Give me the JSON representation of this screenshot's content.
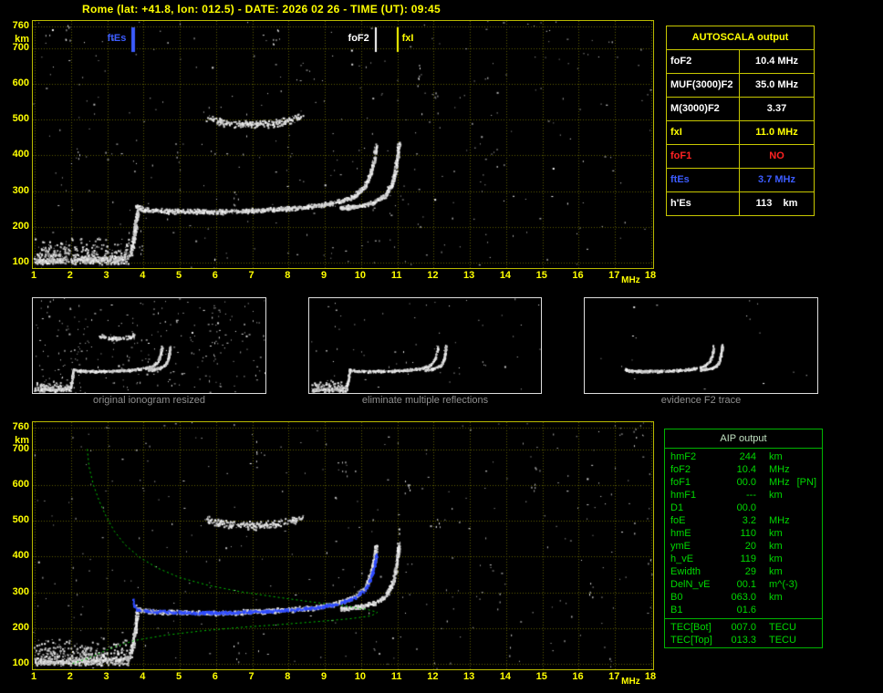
{
  "header": {
    "title": "Rome (lat: +41.8, lon: 012.5) - DATE: 2026 02 26 - TIME (UT): 09:45"
  },
  "colors": {
    "axis_yellow": "#ffff00",
    "grid_olive": "#5f5f00",
    "trace_white": "#ffffff",
    "ftes_blue": "#3c5cff",
    "fxi_yellow": "#ffff00",
    "fof1_red": "#ff2222",
    "profile_green": "#00c800",
    "caption_gray": "#8f8f8f"
  },
  "autoscala_table": {
    "title": "AUTOSCALA output",
    "rows": [
      {
        "label": "foF2",
        "value": "10.4 MHz",
        "color": "#ffffff"
      },
      {
        "label": "MUF(3000)F2",
        "value": "35.0 MHz",
        "color": "#ffffff"
      },
      {
        "label": "M(3000)F2",
        "value": "3.37",
        "color": "#ffffff"
      },
      {
        "label": "fxI",
        "value": "11.0 MHz",
        "color": "#ffff00"
      },
      {
        "label": "foF1",
        "value": "NO",
        "color": "#ff2222"
      },
      {
        "label": "ftEs",
        "value": "3.7 MHz",
        "color": "#3c5cff"
      },
      {
        "label": "h'Es",
        "value": "113    km",
        "color": "#ffffff"
      }
    ]
  },
  "aip_table": {
    "title": "AIP output",
    "rows": [
      {
        "name": "hmF2",
        "value": "244",
        "unit": "km",
        "extra": ""
      },
      {
        "name": "foF2",
        "value": "10.4",
        "unit": "MHz",
        "extra": ""
      },
      {
        "name": "foF1",
        "value": "00.0",
        "unit": "MHz",
        "extra": "[PN]"
      },
      {
        "name": "hmF1",
        "value": "---",
        "unit": "km",
        "extra": ""
      },
      {
        "name": "D1",
        "value": "00.0",
        "unit": "",
        "extra": ""
      },
      {
        "name": "foE",
        "value": "3.2",
        "unit": "MHz",
        "extra": ""
      },
      {
        "name": "hmE",
        "value": "110",
        "unit": "km",
        "extra": ""
      },
      {
        "name": "ymE",
        "value": "20",
        "unit": "km",
        "extra": ""
      },
      {
        "name": "h_vE",
        "value": "119",
        "unit": "km",
        "extra": ""
      },
      {
        "name": "Ewidth",
        "value": "29",
        "unit": "km",
        "extra": ""
      },
      {
        "name": "DelN_vE",
        "value": "00.1",
        "unit": "m^(-3)",
        "extra": ""
      },
      {
        "name": "B0",
        "value": "063.0",
        "unit": "km",
        "extra": ""
      },
      {
        "name": "B1",
        "value": "01.6",
        "unit": "",
        "extra": ""
      }
    ],
    "tec_rows": [
      {
        "name": "TEC[Bot]",
        "value": "007.0",
        "unit": "TECU",
        "extra": ""
      },
      {
        "name": "TEC[Top]",
        "value": "013.3",
        "unit": "TECU",
        "extra": ""
      }
    ]
  },
  "thumbnails": [
    {
      "caption": "original ionogram resized",
      "mode": "original"
    },
    {
      "caption": "eliminate multiple reflections",
      "mode": "filtered"
    },
    {
      "caption": "evidence F2 trace",
      "mode": "trace"
    }
  ],
  "chart_data": [
    {
      "id": "main-ionogram",
      "type": "scatter",
      "title": "recorded ionogram with autoscaled characteristics",
      "xlabel": "MHz",
      "ylabel": "km",
      "xlim": [
        1,
        18
      ],
      "ylim": [
        100,
        760
      ],
      "x_ticks": [
        1,
        2,
        3,
        4,
        5,
        6,
        7,
        8,
        9,
        10,
        11,
        12,
        13,
        14,
        15,
        16,
        17,
        18
      ],
      "y_ticks": [
        100,
        200,
        300,
        400,
        500,
        600,
        700,
        760
      ],
      "grid": true,
      "markers": [
        {
          "label": "ftEs",
          "x": 3.7,
          "color": "#3c5cff",
          "align": "left"
        },
        {
          "label": "foF2",
          "x": 10.4,
          "color": "#ffffff",
          "align": "left"
        },
        {
          "label": "fxI",
          "x": 11.0,
          "color": "#ffff00",
          "align": "right"
        }
      ],
      "noise": {
        "uniform": 330
      },
      "series": [
        {
          "name": "F2-ordinary-trace",
          "color": "#ffffff",
          "style": "scatter",
          "density": 950,
          "jitter": [
            2,
            3
          ],
          "points": [
            [
              3.78,
              260
            ],
            [
              3.95,
              251
            ],
            [
              4.4,
              246
            ],
            [
              5.2,
              244
            ],
            [
              6.2,
              244
            ],
            [
              7.2,
              248
            ],
            [
              8.1,
              253
            ],
            [
              8.8,
              260
            ],
            [
              9.35,
              271
            ],
            [
              9.8,
              288
            ],
            [
              10.08,
              312
            ],
            [
              10.25,
              348
            ],
            [
              10.35,
              390
            ],
            [
              10.41,
              433
            ]
          ]
        },
        {
          "name": "F2-extraordinary-trace",
          "color": "#ffffff",
          "style": "scatter",
          "density": 420,
          "jitter": [
            2,
            3
          ],
          "points": [
            [
              9.4,
              254
            ],
            [
              9.95,
              260
            ],
            [
              10.35,
              270
            ],
            [
              10.65,
              290
            ],
            [
              10.83,
              320
            ],
            [
              10.93,
              358
            ],
            [
              10.99,
              400
            ],
            [
              11.03,
              437
            ]
          ]
        },
        {
          "name": "Es-trace",
          "color": "#ffffff",
          "style": "scatter",
          "density": 170,
          "jitter": [
            2,
            3
          ],
          "points": [
            [
              1.05,
              104
            ],
            [
              1.8,
              108
            ],
            [
              2.6,
              111
            ],
            [
              3.3,
              114
            ],
            [
              3.6,
              118
            ]
          ]
        },
        {
          "name": "Es-cusp",
          "color": "#ffffff",
          "style": "scatter",
          "density": 160,
          "jitter": [
            2,
            4
          ],
          "points": [
            [
              3.62,
              125
            ],
            [
              3.7,
              160
            ],
            [
              3.76,
              200
            ],
            [
              3.8,
              232
            ],
            [
              3.83,
              248
            ]
          ]
        },
        {
          "name": "second-hop-echo",
          "color": "#ffffff",
          "style": "scatter",
          "density": 240,
          "jitter": [
            3,
            5
          ],
          "points": [
            [
              5.75,
              506
            ],
            [
              6.15,
              494
            ],
            [
              6.6,
              488
            ],
            [
              7.15,
              488
            ],
            [
              7.65,
              493
            ],
            [
              8.05,
              500
            ],
            [
              8.35,
              510
            ]
          ]
        },
        {
          "name": "low-frequency-noise",
          "color": "#ffffff",
          "style": "blob",
          "density": 520,
          "region": [
            1.0,
            3.6,
            100,
            178
          ]
        }
      ]
    },
    {
      "id": "aip-ionogram",
      "type": "scatter",
      "title": "ionogram with fitted trace and electron density profile",
      "xlabel": "MHz",
      "ylabel": "km",
      "xlim": [
        1,
        18
      ],
      "ylim": [
        100,
        760
      ],
      "x_ticks": [
        1,
        2,
        3,
        4,
        5,
        6,
        7,
        8,
        9,
        10,
        11,
        12,
        13,
        14,
        15,
        16,
        17,
        18
      ],
      "y_ticks": [
        100,
        200,
        300,
        400,
        500,
        600,
        700,
        760
      ],
      "grid": true,
      "markers": [],
      "noise": {
        "uniform": 300
      },
      "series": [
        {
          "name": "F2-ordinary-trace",
          "color": "#ffffff",
          "style": "scatter",
          "density": 950,
          "jitter": [
            2,
            3
          ],
          "points": [
            [
              3.78,
              260
            ],
            [
              3.95,
              251
            ],
            [
              4.4,
              246
            ],
            [
              5.2,
              244
            ],
            [
              6.2,
              244
            ],
            [
              7.2,
              248
            ],
            [
              8.1,
              253
            ],
            [
              8.8,
              260
            ],
            [
              9.35,
              271
            ],
            [
              9.8,
              288
            ],
            [
              10.08,
              312
            ],
            [
              10.25,
              348
            ],
            [
              10.35,
              390
            ],
            [
              10.41,
              433
            ]
          ]
        },
        {
          "name": "F2-extraordinary-trace",
          "color": "#ffffff",
          "style": "scatter",
          "density": 420,
          "jitter": [
            2,
            3
          ],
          "points": [
            [
              9.4,
              254
            ],
            [
              9.95,
              260
            ],
            [
              10.35,
              270
            ],
            [
              10.65,
              290
            ],
            [
              10.83,
              320
            ],
            [
              10.93,
              358
            ],
            [
              10.99,
              400
            ],
            [
              11.03,
              437
            ]
          ]
        },
        {
          "name": "Es-trace",
          "color": "#ffffff",
          "style": "scatter",
          "density": 170,
          "jitter": [
            2,
            3
          ],
          "points": [
            [
              1.05,
              104
            ],
            [
              1.8,
              108
            ],
            [
              2.6,
              111
            ],
            [
              3.3,
              114
            ],
            [
              3.6,
              118
            ]
          ]
        },
        {
          "name": "Es-cusp",
          "color": "#ffffff",
          "style": "scatter",
          "density": 160,
          "jitter": [
            2,
            4
          ],
          "points": [
            [
              3.62,
              125
            ],
            [
              3.7,
              160
            ],
            [
              3.76,
              200
            ],
            [
              3.8,
              232
            ],
            [
              3.83,
              248
            ]
          ]
        },
        {
          "name": "second-hop-echo",
          "color": "#ffffff",
          "style": "scatter",
          "density": 240,
          "jitter": [
            3,
            5
          ],
          "points": [
            [
              5.75,
              506
            ],
            [
              6.15,
              494
            ],
            [
              6.6,
              488
            ],
            [
              7.15,
              488
            ],
            [
              7.65,
              493
            ],
            [
              8.05,
              500
            ],
            [
              8.35,
              510
            ]
          ]
        },
        {
          "name": "low-frequency-noise",
          "color": "#ffffff",
          "style": "blob",
          "density": 520,
          "region": [
            1.0,
            3.6,
            100,
            178
          ]
        },
        {
          "name": "electron-density-profile",
          "color": "#00c800",
          "style": "line",
          "dash": [
            2,
            3
          ],
          "points": [
            [
              2.45,
              700
            ],
            [
              2.5,
              650
            ],
            [
              2.62,
              600
            ],
            [
              2.78,
              555
            ],
            [
              2.97,
              512
            ],
            [
              3.2,
              470
            ],
            [
              3.5,
              432
            ],
            [
              3.9,
              397
            ],
            [
              4.4,
              367
            ],
            [
              5.0,
              341
            ],
            [
              5.8,
              319
            ],
            [
              6.7,
              301
            ],
            [
              7.7,
              286
            ],
            [
              8.7,
              272
            ],
            [
              9.6,
              261
            ],
            [
              10.2,
              251
            ],
            [
              10.45,
              244
            ],
            [
              10.28,
              234
            ],
            [
              9.7,
              226
            ],
            [
              8.8,
              218
            ],
            [
              7.8,
              210
            ],
            [
              6.7,
              202
            ],
            [
              5.6,
              192
            ],
            [
              4.6,
              180
            ],
            [
              3.8,
              166
            ],
            [
              3.3,
              151
            ],
            [
              2.95,
              137
            ],
            [
              2.65,
              123
            ],
            [
              2.35,
              111
            ],
            [
              2.05,
              101
            ]
          ]
        },
        {
          "name": "autoscaled-trace",
          "color": "#2f4cff",
          "style": "scatter",
          "density": 650,
          "jitter": [
            1,
            2
          ],
          "points": [
            [
              3.7,
              280
            ],
            [
              3.73,
              263
            ],
            [
              3.8,
              252
            ],
            [
              4.2,
              248
            ],
            [
              4.9,
              245
            ],
            [
              5.7,
              244
            ],
            [
              6.5,
              245
            ],
            [
              7.3,
              248
            ],
            [
              8.1,
              252
            ],
            [
              8.8,
              259
            ],
            [
              9.35,
              269
            ],
            [
              9.8,
              285
            ],
            [
              10.1,
              309
            ],
            [
              10.25,
              340
            ],
            [
              10.35,
              374
            ],
            [
              10.41,
              410
            ]
          ]
        }
      ]
    }
  ]
}
